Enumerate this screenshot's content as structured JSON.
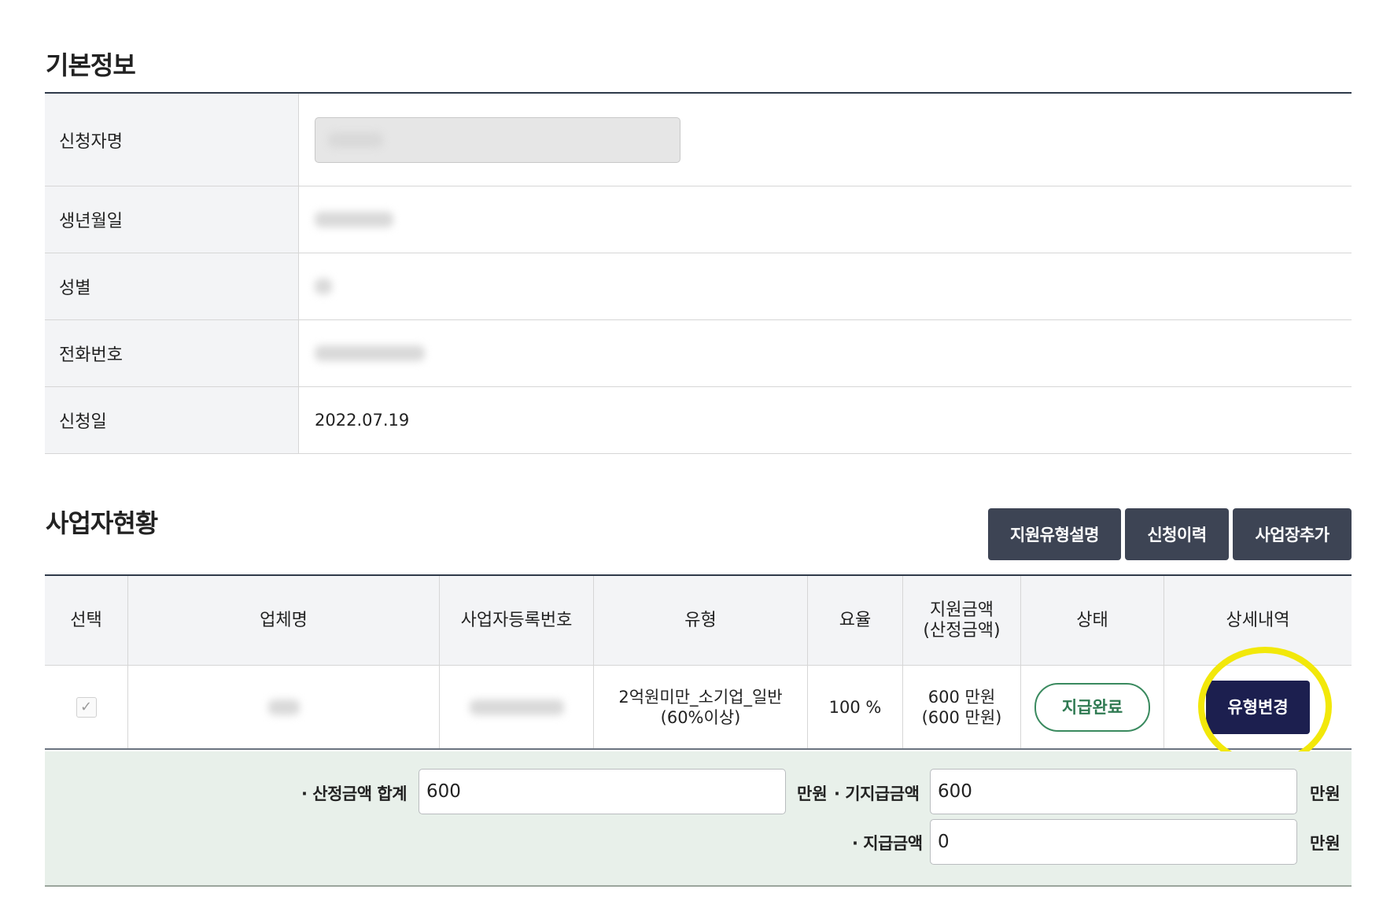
{
  "basic_info": {
    "title": "기본정보",
    "rows": [
      {
        "label": "신청자명",
        "value": ""
      },
      {
        "label": "생년월일",
        "value": ""
      },
      {
        "label": "성별",
        "value": ""
      },
      {
        "label": "전화번호",
        "value": ""
      },
      {
        "label": "신청일",
        "value": "2022.07.19"
      }
    ]
  },
  "business": {
    "title": "사업자현황",
    "buttons": {
      "support_type_desc": "지원유형설명",
      "history": "신청이력",
      "add_business": "사업장추가"
    },
    "columns": {
      "select": "선택",
      "company": "업체명",
      "reg_no": "사업자등록번호",
      "type": "유형",
      "rate": "요율",
      "amount_line1": "지원금액",
      "amount_line2": "(산정금액)",
      "status": "상태",
      "detail": "상세내역"
    },
    "rows": [
      {
        "checked": true,
        "company": "",
        "reg_no": "",
        "type_line1": "2억원미만_소기업_일반",
        "type_line2": "(60%이상)",
        "rate": "100 %",
        "amount_line1": "600 만원",
        "amount_line2": "(600 만원)",
        "status": "지급완료",
        "detail_button": "유형변경"
      }
    ]
  },
  "summary": {
    "calc_total_label": "산정금액 합계",
    "calc_total_value": "600",
    "calc_total_unit": "만원",
    "paid_label": "기지급금액",
    "paid_value": "600",
    "paid_unit": "만원",
    "pay_label": "지급금액",
    "pay_value": "0",
    "pay_unit": "만원"
  }
}
